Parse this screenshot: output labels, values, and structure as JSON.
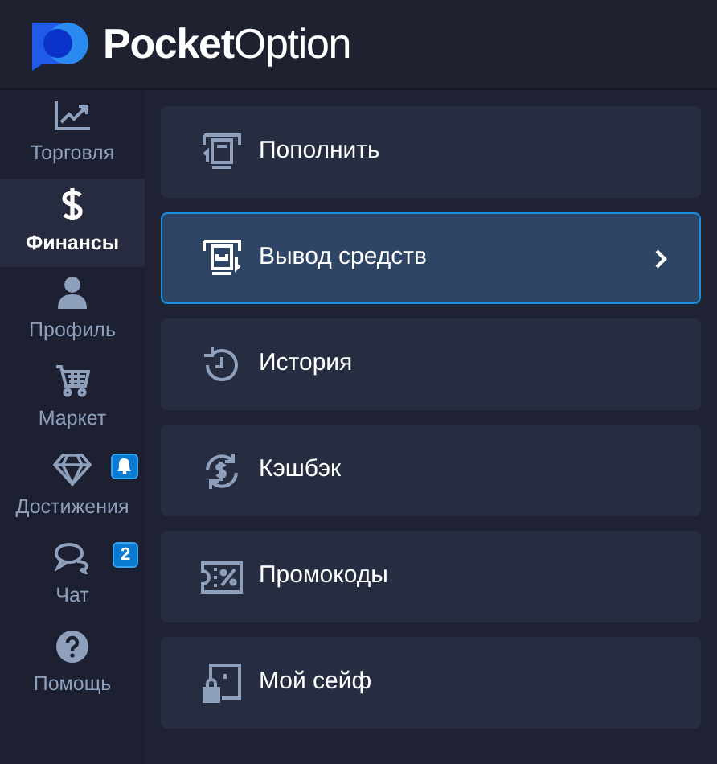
{
  "header": {
    "logo_text": "**Pocket**Option"
  },
  "sidebar": {
    "items": [
      {
        "label": "Торговля",
        "selected": false
      },
      {
        "label": "Финансы",
        "selected": true
      },
      {
        "label": "Профиль",
        "selected": false
      },
      {
        "label": "Маркет",
        "selected": false
      },
      {
        "label": "Достижения",
        "selected": false,
        "badge": {
          "kind": "bell"
        }
      },
      {
        "label": "Чат",
        "selected": false,
        "badge": {
          "kind": "count",
          "text": "2"
        }
      },
      {
        "label": "Помощь",
        "selected": false
      }
    ]
  },
  "menu": [
    {
      "label": "Пополнить",
      "selected": false
    },
    {
      "label": "Вывод средств",
      "selected": true
    },
    {
      "label": "История",
      "selected": false
    },
    {
      "label": "Кэшбэк",
      "selected": false
    },
    {
      "label": "Промокоды",
      "selected": false
    },
    {
      "label": "Мой сейф",
      "selected": false
    }
  ]
}
